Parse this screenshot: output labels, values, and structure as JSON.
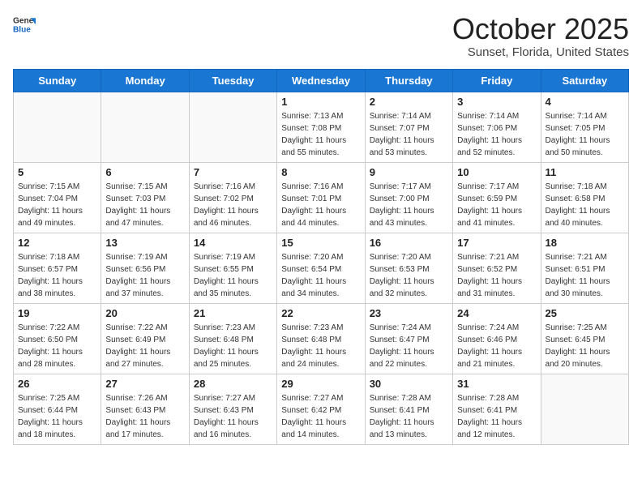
{
  "logo": {
    "general": "General",
    "blue": "Blue"
  },
  "header": {
    "month": "October 2025",
    "location": "Sunset, Florida, United States"
  },
  "weekdays": [
    "Sunday",
    "Monday",
    "Tuesday",
    "Wednesday",
    "Thursday",
    "Friday",
    "Saturday"
  ],
  "weeks": [
    [
      {
        "day": "",
        "info": ""
      },
      {
        "day": "",
        "info": ""
      },
      {
        "day": "",
        "info": ""
      },
      {
        "day": "1",
        "info": "Sunrise: 7:13 AM\nSunset: 7:08 PM\nDaylight: 11 hours\nand 55 minutes."
      },
      {
        "day": "2",
        "info": "Sunrise: 7:14 AM\nSunset: 7:07 PM\nDaylight: 11 hours\nand 53 minutes."
      },
      {
        "day": "3",
        "info": "Sunrise: 7:14 AM\nSunset: 7:06 PM\nDaylight: 11 hours\nand 52 minutes."
      },
      {
        "day": "4",
        "info": "Sunrise: 7:14 AM\nSunset: 7:05 PM\nDaylight: 11 hours\nand 50 minutes."
      }
    ],
    [
      {
        "day": "5",
        "info": "Sunrise: 7:15 AM\nSunset: 7:04 PM\nDaylight: 11 hours\nand 49 minutes."
      },
      {
        "day": "6",
        "info": "Sunrise: 7:15 AM\nSunset: 7:03 PM\nDaylight: 11 hours\nand 47 minutes."
      },
      {
        "day": "7",
        "info": "Sunrise: 7:16 AM\nSunset: 7:02 PM\nDaylight: 11 hours\nand 46 minutes."
      },
      {
        "day": "8",
        "info": "Sunrise: 7:16 AM\nSunset: 7:01 PM\nDaylight: 11 hours\nand 44 minutes."
      },
      {
        "day": "9",
        "info": "Sunrise: 7:17 AM\nSunset: 7:00 PM\nDaylight: 11 hours\nand 43 minutes."
      },
      {
        "day": "10",
        "info": "Sunrise: 7:17 AM\nSunset: 6:59 PM\nDaylight: 11 hours\nand 41 minutes."
      },
      {
        "day": "11",
        "info": "Sunrise: 7:18 AM\nSunset: 6:58 PM\nDaylight: 11 hours\nand 40 minutes."
      }
    ],
    [
      {
        "day": "12",
        "info": "Sunrise: 7:18 AM\nSunset: 6:57 PM\nDaylight: 11 hours\nand 38 minutes."
      },
      {
        "day": "13",
        "info": "Sunrise: 7:19 AM\nSunset: 6:56 PM\nDaylight: 11 hours\nand 37 minutes."
      },
      {
        "day": "14",
        "info": "Sunrise: 7:19 AM\nSunset: 6:55 PM\nDaylight: 11 hours\nand 35 minutes."
      },
      {
        "day": "15",
        "info": "Sunrise: 7:20 AM\nSunset: 6:54 PM\nDaylight: 11 hours\nand 34 minutes."
      },
      {
        "day": "16",
        "info": "Sunrise: 7:20 AM\nSunset: 6:53 PM\nDaylight: 11 hours\nand 32 minutes."
      },
      {
        "day": "17",
        "info": "Sunrise: 7:21 AM\nSunset: 6:52 PM\nDaylight: 11 hours\nand 31 minutes."
      },
      {
        "day": "18",
        "info": "Sunrise: 7:21 AM\nSunset: 6:51 PM\nDaylight: 11 hours\nand 30 minutes."
      }
    ],
    [
      {
        "day": "19",
        "info": "Sunrise: 7:22 AM\nSunset: 6:50 PM\nDaylight: 11 hours\nand 28 minutes."
      },
      {
        "day": "20",
        "info": "Sunrise: 7:22 AM\nSunset: 6:49 PM\nDaylight: 11 hours\nand 27 minutes."
      },
      {
        "day": "21",
        "info": "Sunrise: 7:23 AM\nSunset: 6:48 PM\nDaylight: 11 hours\nand 25 minutes."
      },
      {
        "day": "22",
        "info": "Sunrise: 7:23 AM\nSunset: 6:48 PM\nDaylight: 11 hours\nand 24 minutes."
      },
      {
        "day": "23",
        "info": "Sunrise: 7:24 AM\nSunset: 6:47 PM\nDaylight: 11 hours\nand 22 minutes."
      },
      {
        "day": "24",
        "info": "Sunrise: 7:24 AM\nSunset: 6:46 PM\nDaylight: 11 hours\nand 21 minutes."
      },
      {
        "day": "25",
        "info": "Sunrise: 7:25 AM\nSunset: 6:45 PM\nDaylight: 11 hours\nand 20 minutes."
      }
    ],
    [
      {
        "day": "26",
        "info": "Sunrise: 7:25 AM\nSunset: 6:44 PM\nDaylight: 11 hours\nand 18 minutes."
      },
      {
        "day": "27",
        "info": "Sunrise: 7:26 AM\nSunset: 6:43 PM\nDaylight: 11 hours\nand 17 minutes."
      },
      {
        "day": "28",
        "info": "Sunrise: 7:27 AM\nSunset: 6:43 PM\nDaylight: 11 hours\nand 16 minutes."
      },
      {
        "day": "29",
        "info": "Sunrise: 7:27 AM\nSunset: 6:42 PM\nDaylight: 11 hours\nand 14 minutes."
      },
      {
        "day": "30",
        "info": "Sunrise: 7:28 AM\nSunset: 6:41 PM\nDaylight: 11 hours\nand 13 minutes."
      },
      {
        "day": "31",
        "info": "Sunrise: 7:28 AM\nSunset: 6:41 PM\nDaylight: 11 hours\nand 12 minutes."
      },
      {
        "day": "",
        "info": ""
      }
    ]
  ]
}
